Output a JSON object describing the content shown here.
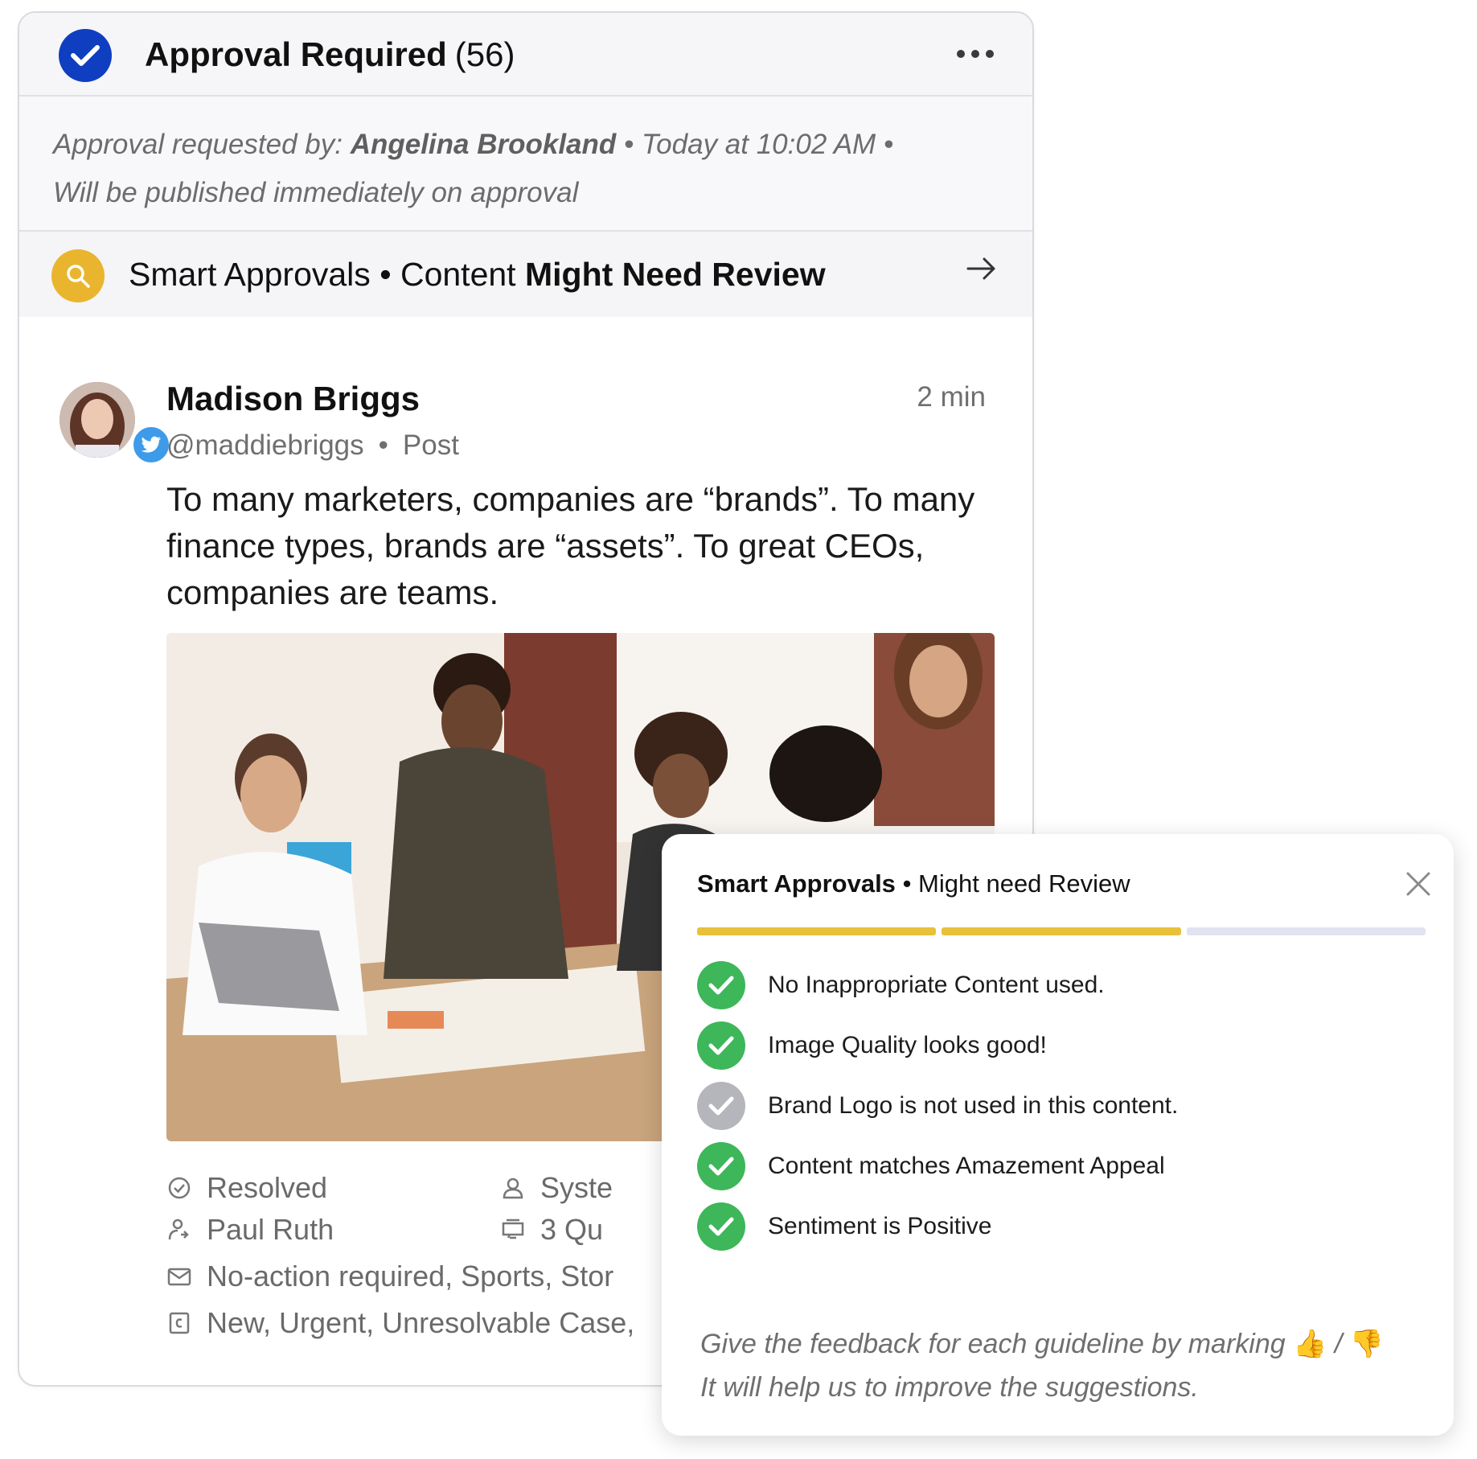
{
  "header": {
    "title": "Approval Required",
    "count": "(56)",
    "accent": "#0f3fc0",
    "check_icon": "check-circle-icon",
    "more_icon": "more-horizontal-icon"
  },
  "meta": {
    "requested_by_label": "Approval requested by:",
    "requester": "Angelina Brookland",
    "time": "Today at 10:02 AM",
    "publish_note": "Will be published immediately on approval"
  },
  "smart_bar": {
    "label": "Smart Approvals",
    "separator": "•",
    "status_prefix": "Content",
    "status_bold": "Might Need Review",
    "icon": "search-icon",
    "icon_color": "#eab52e",
    "arrow_icon": "arrow-right-icon"
  },
  "post": {
    "author": "Madison Briggs",
    "handle": "@maddiebriggs",
    "type": "Post",
    "time": "2 min",
    "network_icon": "twitter-icon",
    "text": "To many marketers, companies are “brands”. To many finance types, brands are “assets”. To great CEOs, companies are teams."
  },
  "properties": {
    "status": "Resolved",
    "system": "Syste",
    "assignee": "Paul Ruth",
    "queue": "3 Qu",
    "tags": "No-action required,  Sports,  Stor",
    "case_tags": "New, Urgent, Unresolvable Case,"
  },
  "popup": {
    "title_bold": "Smart Approvals",
    "separator": "•",
    "title_rest": "Might need Review",
    "close_icon": "close-icon",
    "progress": {
      "segments_total": 3,
      "segments_filled": 2,
      "fill_color": "#e8c13a",
      "empty_color": "#e2e3f0"
    },
    "checks": [
      {
        "text": "No Inappropriate Content used.",
        "state": "pass"
      },
      {
        "text": "Image Quality looks good!",
        "state": "pass"
      },
      {
        "text": "Brand Logo is not used in this content.",
        "state": "neutral"
      },
      {
        "text": "Content matches Amazement Appeal",
        "state": "pass"
      },
      {
        "text": "Sentiment is Positive",
        "state": "pass"
      }
    ],
    "pass_color": "#3eb65a",
    "neutral_color": "#b5b6bc",
    "feedback_line1": "Give the feedback for each guideline by marking",
    "thumbs_up": "👍",
    "slash": "/",
    "thumbs_down": "👎",
    "feedback_line2": "It will help us to improve the suggestions."
  }
}
